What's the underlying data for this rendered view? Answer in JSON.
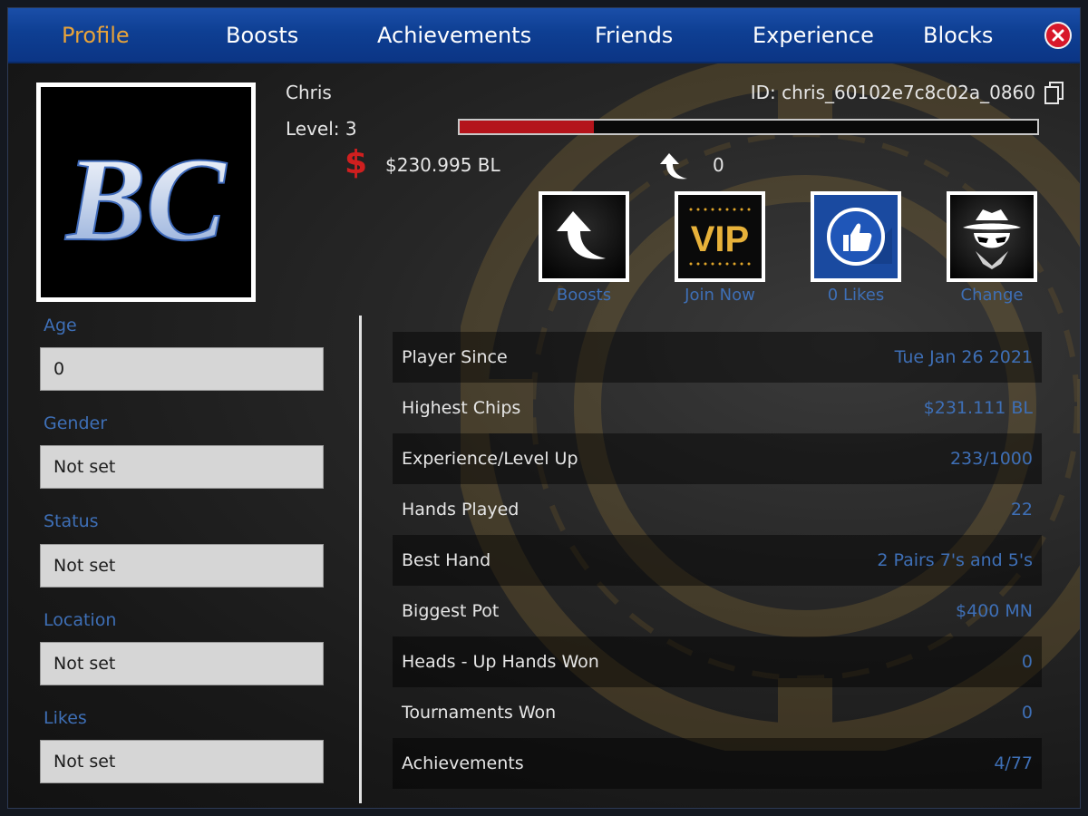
{
  "nav": {
    "tabs": [
      {
        "label": "Profile",
        "active": true
      },
      {
        "label": "Boosts"
      },
      {
        "label": "Achievements"
      },
      {
        "label": "Friends"
      },
      {
        "label": "Experience"
      },
      {
        "label": "Blocks"
      }
    ],
    "close_icon": "close-icon"
  },
  "colors": {
    "nav_blue": "#0e3f93",
    "active_tab": "#e8a33a",
    "accent_blue": "#3e6fb6",
    "xp_red": "#b4141b",
    "close_red": "#d8182a"
  },
  "profile": {
    "avatar_text": "BC",
    "name": "Chris",
    "id_text": "ID: chris_60102e7c8c02a_0860",
    "level_text": "Level: 3",
    "xp_progress": 0.233,
    "dollar_symbol": "$",
    "chips": "$230.995 BL",
    "boost_count": "0"
  },
  "actions": [
    {
      "caption": "Boosts",
      "icon": "boost-arrow-icon"
    },
    {
      "caption": "Join Now",
      "icon": "vip-icon",
      "icon_text": "VIP"
    },
    {
      "caption": "0 Likes",
      "icon": "thumbs-up-icon"
    },
    {
      "caption": "Change",
      "icon": "incognito-spy-icon"
    }
  ],
  "fields": [
    {
      "label": "Age",
      "value": "0"
    },
    {
      "label": "Gender",
      "value": "Not set"
    },
    {
      "label": "Status",
      "value": "Not set"
    },
    {
      "label": "Location",
      "value": "Not set"
    },
    {
      "label": "Likes",
      "value": "Not set"
    }
  ],
  "stats": [
    {
      "label": "Player Since",
      "value": "Tue Jan 26 2021"
    },
    {
      "label": "Highest Chips",
      "value": "$231.111 BL"
    },
    {
      "label": "Experience/Level Up",
      "value": "233/1000"
    },
    {
      "label": "Hands Played",
      "value": "22"
    },
    {
      "label": "Best Hand",
      "value": "2 Pairs 7's and 5's"
    },
    {
      "label": "Biggest Pot",
      "value": "$400 MN"
    },
    {
      "label": "Heads - Up Hands Won",
      "value": "0"
    },
    {
      "label": "Tournaments Won",
      "value": "0"
    },
    {
      "label": "Achievements",
      "value": "4/77"
    }
  ]
}
